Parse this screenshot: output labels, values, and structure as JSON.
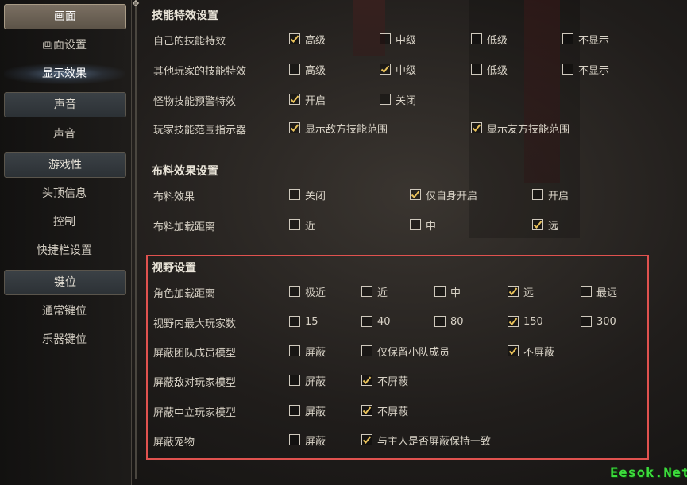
{
  "sidebar": {
    "categories": [
      {
        "label": "画面",
        "items": [
          "画面设置",
          "显示效果"
        ]
      },
      {
        "label": "声音",
        "items": [
          "声音"
        ]
      },
      {
        "label": "游戏性",
        "items": [
          "头顶信息",
          "控制",
          "快捷栏设置"
        ]
      },
      {
        "label": "键位",
        "items": [
          "通常键位",
          "乐器键位"
        ]
      }
    ],
    "active_category": "画面",
    "selected_item": "显示效果"
  },
  "sections": {
    "skill": {
      "title": "技能特效设置",
      "rows": [
        {
          "label": "自己的技能特效",
          "options": [
            {
              "label": "高级",
              "checked": true
            },
            {
              "label": "中级",
              "checked": false
            },
            {
              "label": "低级",
              "checked": false
            },
            {
              "label": "不显示",
              "checked": false
            }
          ]
        },
        {
          "label": "其他玩家的技能特效",
          "options": [
            {
              "label": "高级",
              "checked": false
            },
            {
              "label": "中级",
              "checked": true
            },
            {
              "label": "低级",
              "checked": false
            },
            {
              "label": "不显示",
              "checked": false
            }
          ]
        },
        {
          "label": "怪物技能预警特效",
          "options": [
            {
              "label": "开启",
              "checked": true
            },
            {
              "label": "关闭",
              "checked": false
            }
          ]
        },
        {
          "label": "玩家技能范围指示器",
          "options": [
            {
              "label": "显示敌方技能范围",
              "checked": true
            },
            {
              "label": "显示友方技能范围",
              "checked": true
            }
          ]
        }
      ]
    },
    "cloth": {
      "title": "布料效果设置",
      "rows": [
        {
          "label": "布料效果",
          "options": [
            {
              "label": "关闭",
              "checked": false
            },
            {
              "label": "仅自身开启",
              "checked": true
            },
            {
              "label": "开启",
              "checked": false
            }
          ]
        },
        {
          "label": "布料加载距离",
          "options": [
            {
              "label": "近",
              "checked": false
            },
            {
              "label": "中",
              "checked": false
            },
            {
              "label": "远",
              "checked": true
            }
          ]
        }
      ]
    },
    "view": {
      "title": "视野设置",
      "rows": [
        {
          "label": "角色加载距离",
          "options": [
            {
              "label": "极近",
              "checked": false
            },
            {
              "label": "近",
              "checked": false
            },
            {
              "label": "中",
              "checked": false
            },
            {
              "label": "远",
              "checked": true
            },
            {
              "label": "最远",
              "checked": false
            }
          ]
        },
        {
          "label": "视野内最大玩家数",
          "options": [
            {
              "label": "15",
              "checked": false
            },
            {
              "label": "40",
              "checked": false
            },
            {
              "label": "80",
              "checked": false
            },
            {
              "label": "150",
              "checked": true
            },
            {
              "label": "300",
              "checked": false
            }
          ]
        },
        {
          "label": "屏蔽团队成员模型",
          "options": [
            {
              "label": "屏蔽",
              "checked": false
            },
            {
              "label": "仅保留小队成员",
              "checked": false
            },
            {
              "label": "不屏蔽",
              "checked": true
            }
          ]
        },
        {
          "label": "屏蔽敌对玩家模型",
          "options": [
            {
              "label": "屏蔽",
              "checked": false
            },
            {
              "label": "不屏蔽",
              "checked": true
            }
          ]
        },
        {
          "label": "屏蔽中立玩家模型",
          "options": [
            {
              "label": "屏蔽",
              "checked": false
            },
            {
              "label": "不屏蔽",
              "checked": true
            }
          ]
        },
        {
          "label": "屏蔽宠物",
          "options": [
            {
              "label": "屏蔽",
              "checked": false
            },
            {
              "label": "与主人是否屏蔽保持一致",
              "checked": true
            }
          ]
        }
      ]
    }
  },
  "watermark": "Eesok.Net",
  "colors": {
    "accent": "#e0524f",
    "checkmark": "#e8c15a",
    "watermark": "#3ddc3d"
  }
}
